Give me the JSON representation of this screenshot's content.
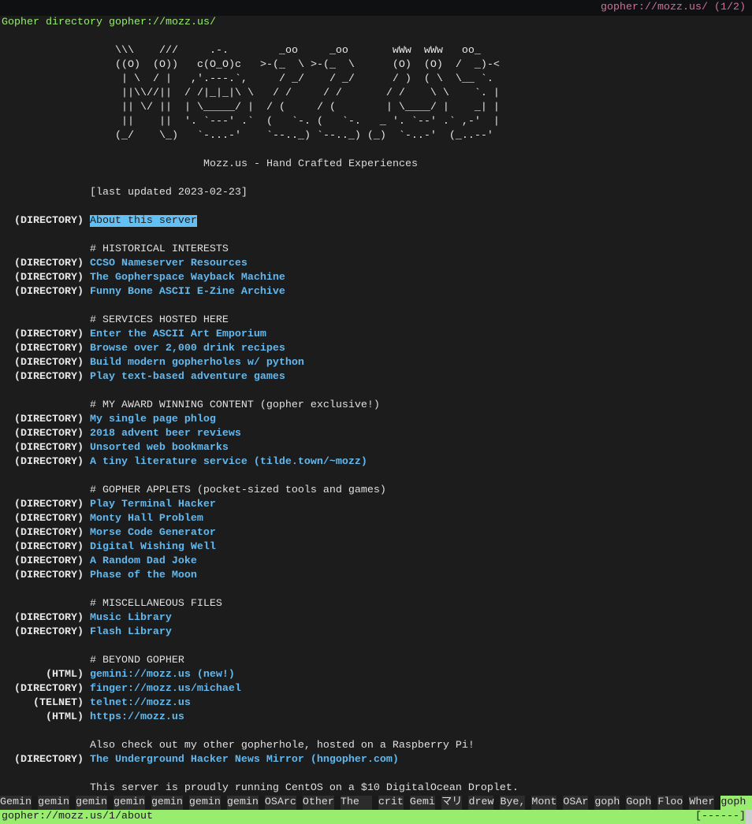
{
  "window": {
    "title": "gopher://mozz.us/ (1/2)"
  },
  "page_heading": "Gopher directory gopher://mozz.us/",
  "ascii_art": [
    "\\\\\\    ///     .-.        _oo     _oo       wWw  wWw   oo_",
    "((O)  (O))   c(O_O)c   >-(_  \\ >-(_  \\      (O)  (O)  /  _)-<",
    " | \\  / |   ,'.---.`,     / _/    / _/      / )  ( \\  \\__ `.",
    " ||\\\\//||  / /|_|_|\\ \\   / /     / /       / /    \\ \\    `. |",
    " || \\/ ||  | \\_____/ |  / (     / (        | \\____/ |    _| |",
    " ||    ||  '. `---' .`  (   `-. (   `-.   _ '. `--' .` ,-'  |",
    "(_/    \\_)   `-...-'    `--.._) `--.._) (_)  `-..-'  (_..--'"
  ],
  "tagline": "Mozz.us - Hand Crafted Experiences",
  "lines": [
    {
      "row": 12,
      "type": "text",
      "text": "[last updated 2023-02-23]"
    },
    {
      "row": 14,
      "type": "link",
      "label": "(DIRECTORY)",
      "text": "About this server",
      "selected": true
    },
    {
      "row": 16,
      "type": "text",
      "text": "# HISTORICAL INTERESTS"
    },
    {
      "row": 17,
      "type": "link",
      "label": "(DIRECTORY)",
      "text": "CCSO Nameserver Resources"
    },
    {
      "row": 18,
      "type": "link",
      "label": "(DIRECTORY)",
      "text": "The Gopherspace Wayback Machine"
    },
    {
      "row": 19,
      "type": "link",
      "label": "(DIRECTORY)",
      "text": "Funny Bone ASCII E-Zine Archive"
    },
    {
      "row": 21,
      "type": "text",
      "text": "# SERVICES HOSTED HERE"
    },
    {
      "row": 22,
      "type": "link",
      "label": "(DIRECTORY)",
      "text": "Enter the ASCII Art Emporium"
    },
    {
      "row": 23,
      "type": "link",
      "label": "(DIRECTORY)",
      "text": "Browse over 2,000 drink recipes"
    },
    {
      "row": 24,
      "type": "link",
      "label": "(DIRECTORY)",
      "text": "Build modern gopherholes w/ python"
    },
    {
      "row": 25,
      "type": "link",
      "label": "(DIRECTORY)",
      "text": "Play text-based adventure games"
    },
    {
      "row": 27,
      "type": "text",
      "text": "# MY AWARD WINNING CONTENT (gopher exclusive!)"
    },
    {
      "row": 28,
      "type": "link",
      "label": "(DIRECTORY)",
      "text": "My single page phlog"
    },
    {
      "row": 29,
      "type": "link",
      "label": "(DIRECTORY)",
      "text": "2018 advent beer reviews"
    },
    {
      "row": 30,
      "type": "link",
      "label": "(DIRECTORY)",
      "text": "Unsorted web bookmarks"
    },
    {
      "row": 31,
      "type": "link",
      "label": "(DIRECTORY)",
      "text": "A tiny literature service (tilde.town/~mozz)"
    },
    {
      "row": 33,
      "type": "text",
      "text": "# GOPHER APPLETS (pocket-sized tools and games)"
    },
    {
      "row": 34,
      "type": "link",
      "label": "(DIRECTORY)",
      "text": "Play Terminal Hacker"
    },
    {
      "row": 35,
      "type": "link",
      "label": "(DIRECTORY)",
      "text": "Monty Hall Problem"
    },
    {
      "row": 36,
      "type": "link",
      "label": "(DIRECTORY)",
      "text": "Morse Code Generator"
    },
    {
      "row": 37,
      "type": "link",
      "label": "(DIRECTORY)",
      "text": "Digital Wishing Well"
    },
    {
      "row": 38,
      "type": "link",
      "label": "(DIRECTORY)",
      "text": "A Random Dad Joke"
    },
    {
      "row": 39,
      "type": "link",
      "label": "(DIRECTORY)",
      "text": "Phase of the Moon"
    },
    {
      "row": 41,
      "type": "text",
      "text": "# MISCELLANEOUS FILES"
    },
    {
      "row": 42,
      "type": "link",
      "label": "(DIRECTORY)",
      "text": "Music Library"
    },
    {
      "row": 43,
      "type": "link",
      "label": "(DIRECTORY)",
      "text": "Flash Library"
    },
    {
      "row": 45,
      "type": "text",
      "text": "# BEYOND GOPHER"
    },
    {
      "row": 46,
      "type": "link",
      "label": "(HTML)",
      "text": "gemini://mozz.us (new!)"
    },
    {
      "row": 47,
      "type": "link",
      "label": "(DIRECTORY)",
      "text": "finger://mozz.us/michael"
    },
    {
      "row": 48,
      "type": "link",
      "label": "(TELNET)",
      "text": "telnet://mozz.us"
    },
    {
      "row": 49,
      "type": "link",
      "label": "(HTML)",
      "text": "https://mozz.us"
    },
    {
      "row": 51,
      "type": "text",
      "text": "Also check out my other gopherhole, hosted on a Raspberry Pi!"
    },
    {
      "row": 52,
      "type": "link",
      "label": "(DIRECTORY)",
      "text": "The Underground Hacker News Mirror (hngopher.com)"
    },
    {
      "row": 54,
      "type": "text",
      "text": "This server is proudly running CentOS on a $10 DigitalOcean Droplet."
    }
  ],
  "tabs": [
    "Gemin",
    "gemin",
    "gemin",
    "gemin",
    "gemin",
    "gemin",
    "gemin",
    "OSArc",
    "Other",
    "The  ",
    "crit",
    "Gemi",
    "マリ",
    "drew",
    "Bye,",
    "Mont",
    "OSAr",
    "goph",
    "Goph",
    "Floo",
    "Wher",
    "goph"
  ],
  "active_tab": 21,
  "status": {
    "url": "gopher://mozz.us/1/about",
    "progress": "[------]"
  },
  "colors": {
    "link": "#63b8ee",
    "selected_bg": "#63c0f5",
    "status_bar": "#98ec6e",
    "title": "#d16f9b",
    "heading": "#98ec6e"
  }
}
